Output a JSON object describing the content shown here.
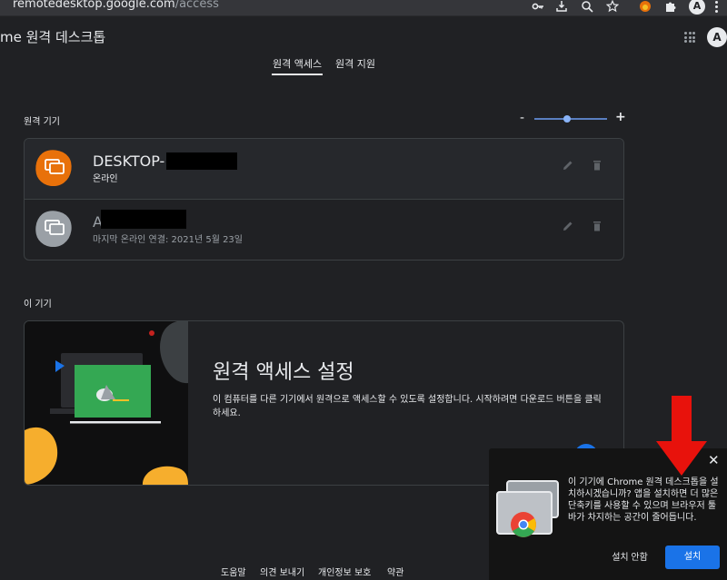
{
  "browser": {
    "url_host": "remotedesktop.google.com",
    "url_path": "/access",
    "profile_initial": "A"
  },
  "header": {
    "app_title": "me 원격 데스크톱",
    "account_initial": "A"
  },
  "tabs": [
    {
      "label": "원격 액세스",
      "active": true
    },
    {
      "label": "원격 지원",
      "active": false
    }
  ],
  "remote_devices": {
    "section_label": "원격 기기",
    "zoom_minus": "-",
    "zoom_plus": "+",
    "zoom_level": 0.45,
    "devices": [
      {
        "name": "DESKTOP-",
        "status": "온라인",
        "online": true
      },
      {
        "name": "A",
        "status": "마지막 온라인 연결: 2021년 5월 23일",
        "online": false
      }
    ]
  },
  "this_device": {
    "section_label": "이 기기",
    "title": "원격 액세스 설정",
    "description": "이 컴퓨터를 다른 기기에서 원격으로 액세스할 수 있도록 설정합니다. 시작하려면 다운로드 버튼을 클릭하세요."
  },
  "footer": {
    "links": [
      "도움말",
      "의견 보내기",
      "개인정보 보호",
      "약관"
    ]
  },
  "install_popup": {
    "close": "✕",
    "message": "이 기기에 Chrome 원격 데스크톱을 설치하시겠습니까? 앱을 설치하면 더 많은 단축키를 사용할 수 있으며 브라우저 툴바가 차지하는 공간이 줄어듭니다.",
    "cancel_label": "설치 안함",
    "install_label": "설치"
  },
  "colors": {
    "accent": "#8ab4f8",
    "primary_button": "#1a73e8",
    "online_device": "#e8710a",
    "offline_device": "#9aa0a6",
    "annotation_arrow": "#e8120c"
  }
}
